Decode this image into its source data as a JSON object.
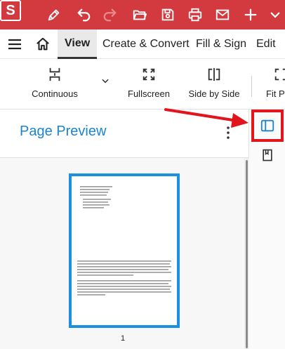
{
  "app": {
    "logo_letter": "S"
  },
  "titlebar_icons": [
    "edit-icon",
    "undo-icon",
    "redo-icon",
    "open-folder-icon",
    "save-icon",
    "print-icon",
    "email-icon",
    "add-icon",
    "chevron-down-icon"
  ],
  "menu": {
    "tabs": [
      {
        "label": "View",
        "active": true
      },
      {
        "label": "Create & Convert",
        "active": false
      },
      {
        "label": "Fill & Sign",
        "active": false
      },
      {
        "label": "Edit",
        "active": false
      }
    ]
  },
  "toolbar": {
    "continuous_label": "Continuous",
    "fullscreen_label": "Fullscreen",
    "side_by_side_label": "Side by Side",
    "fit_label": "Fit P"
  },
  "panel": {
    "title": "Page Preview",
    "page_number": "1"
  },
  "colors": {
    "brand_red": "#d33a3f",
    "accent_blue": "#1b84cc",
    "highlight_red": "#e2151d"
  }
}
